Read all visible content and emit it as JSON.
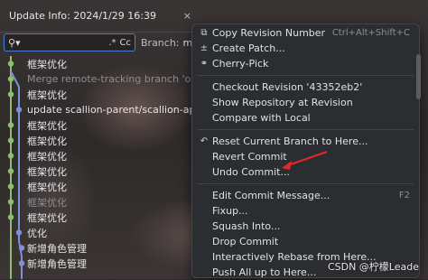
{
  "header": {
    "title": "Update Info: 2024/1/29 16:39",
    "close_label": "×"
  },
  "search": {
    "value": "",
    "regex_label": ".*",
    "case_label": "Cc"
  },
  "branch": {
    "label": "Branch:",
    "value": "mas"
  },
  "commits": [
    {
      "message": "框架优化",
      "dim": false
    },
    {
      "message": "Merge remote-tracking branch 'origin/m",
      "dim": true
    },
    {
      "message": "框架优化",
      "dim": false
    },
    {
      "message": "update scallion-parent/scallion-app/src",
      "dim": false
    },
    {
      "message": "框架优化",
      "dim": false
    },
    {
      "message": "框架优化",
      "dim": false
    },
    {
      "message": "框架优化",
      "dim": false
    },
    {
      "message": "框架优化",
      "dim": false
    },
    {
      "message": "框架优化",
      "dim": false
    },
    {
      "message": "框架优化",
      "dim": true
    },
    {
      "message": "框架优化",
      "dim": false
    },
    {
      "message": "优化",
      "dim": false
    },
    {
      "message": "新增角色管理",
      "dim": false
    },
    {
      "message": "新增角色管理",
      "dim": false
    }
  ],
  "menu": {
    "groups": [
      [
        {
          "icon": "copy-icon",
          "glyph": "⧉",
          "label": "Copy Revision Number",
          "shortcut": "Ctrl+Alt+Shift+C"
        },
        {
          "icon": "patch-icon",
          "glyph": "±",
          "label": "Create Patch...",
          "shortcut": ""
        },
        {
          "icon": "cherry-pick-icon",
          "glyph": "⚭",
          "label": "Cherry-Pick",
          "shortcut": ""
        }
      ],
      [
        {
          "icon": "",
          "glyph": "",
          "label": "Checkout Revision '43352eb2'",
          "shortcut": ""
        },
        {
          "icon": "",
          "glyph": "",
          "label": "Show Repository at Revision",
          "shortcut": ""
        },
        {
          "icon": "",
          "glyph": "",
          "label": "Compare with Local",
          "shortcut": ""
        }
      ],
      [
        {
          "icon": "reset-icon",
          "glyph": "↶",
          "label": "Reset Current Branch to Here...",
          "shortcut": ""
        },
        {
          "icon": "",
          "glyph": "",
          "label": "Revert Commit",
          "shortcut": ""
        },
        {
          "icon": "",
          "glyph": "",
          "label": "Undo Commit...",
          "shortcut": ""
        }
      ],
      [
        {
          "icon": "",
          "glyph": "",
          "label": "Edit Commit Message...",
          "shortcut": "F2"
        },
        {
          "icon": "",
          "glyph": "",
          "label": "Fixup...",
          "shortcut": ""
        },
        {
          "icon": "",
          "glyph": "",
          "label": "Squash Into...",
          "shortcut": ""
        },
        {
          "icon": "",
          "glyph": "",
          "label": "Drop Commit",
          "shortcut": ""
        },
        {
          "icon": "",
          "glyph": "",
          "label": "Interactively Rebase from Here...",
          "shortcut": ""
        },
        {
          "icon": "",
          "glyph": "",
          "label": "Push All up to Here...",
          "shortcut": ""
        }
      ]
    ]
  },
  "watermark": "CSDN @柠檬Leade",
  "colors": {
    "annotation_arrow": "#e0282d",
    "graph_main": "#8fbf6a",
    "graph_branch": "#7f8fd8",
    "search_border": "#4d7ddb"
  }
}
